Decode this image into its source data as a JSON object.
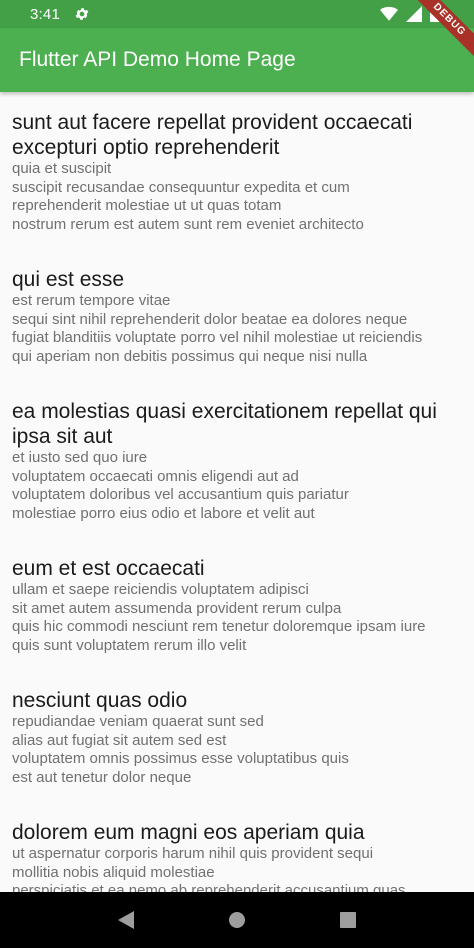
{
  "status_bar": {
    "time": "3:41",
    "icons": [
      "gear-icon",
      "wifi-icon",
      "signal-icon",
      "battery-icon"
    ]
  },
  "debug_banner": {
    "label": "DEBUG"
  },
  "app_bar": {
    "title": "Flutter API Demo Home Page"
  },
  "posts": [
    {
      "title": "sunt aut facere repellat provident occaecati excepturi optio reprehenderit",
      "body": "quia et suscipit\nsuscipit recusandae consequuntur expedita et cum\nreprehenderit molestiae ut ut quas totam\nnostrum rerum est autem sunt rem eveniet architecto"
    },
    {
      "title": "qui est esse",
      "body": "est rerum tempore vitae\nsequi sint nihil reprehenderit dolor beatae ea dolores neque\nfugiat blanditiis voluptate porro vel nihil molestiae ut reiciendis\nqui aperiam non debitis possimus qui neque nisi nulla"
    },
    {
      "title": "ea molestias quasi exercitationem repellat qui ipsa sit aut",
      "body": "et iusto sed quo iure\nvoluptatem occaecati omnis eligendi aut ad\nvoluptatem doloribus vel accusantium quis pariatur\nmolestiae porro eius odio et labore et velit aut"
    },
    {
      "title": "eum et est occaecati",
      "body": "ullam et saepe reiciendis voluptatem adipisci\nsit amet autem assumenda provident rerum culpa\nquis hic commodi nesciunt rem tenetur doloremque ipsam iure\nquis sunt voluptatem rerum illo velit"
    },
    {
      "title": "nesciunt quas odio",
      "body": "repudiandae veniam quaerat sunt sed\nalias aut fugiat sit autem sed est\nvoluptatem omnis possimus esse voluptatibus quis\nest aut tenetur dolor neque"
    },
    {
      "title": "dolorem eum magni eos aperiam quia",
      "body": "ut aspernatur corporis harum nihil quis provident sequi\nmollitia nobis aliquid molestiae\nperspiciatis et ea nemo ab reprehenderit accusantium quas\nvoluptate dolores velit et doloremque molestiae"
    }
  ],
  "nav_bar": {
    "buttons": [
      "back-icon",
      "home-icon",
      "recents-icon"
    ]
  },
  "colors": {
    "status_bar": "#43a047",
    "app_bar": "#4caf50",
    "background": "#fafafa",
    "debug": "#a83228"
  }
}
